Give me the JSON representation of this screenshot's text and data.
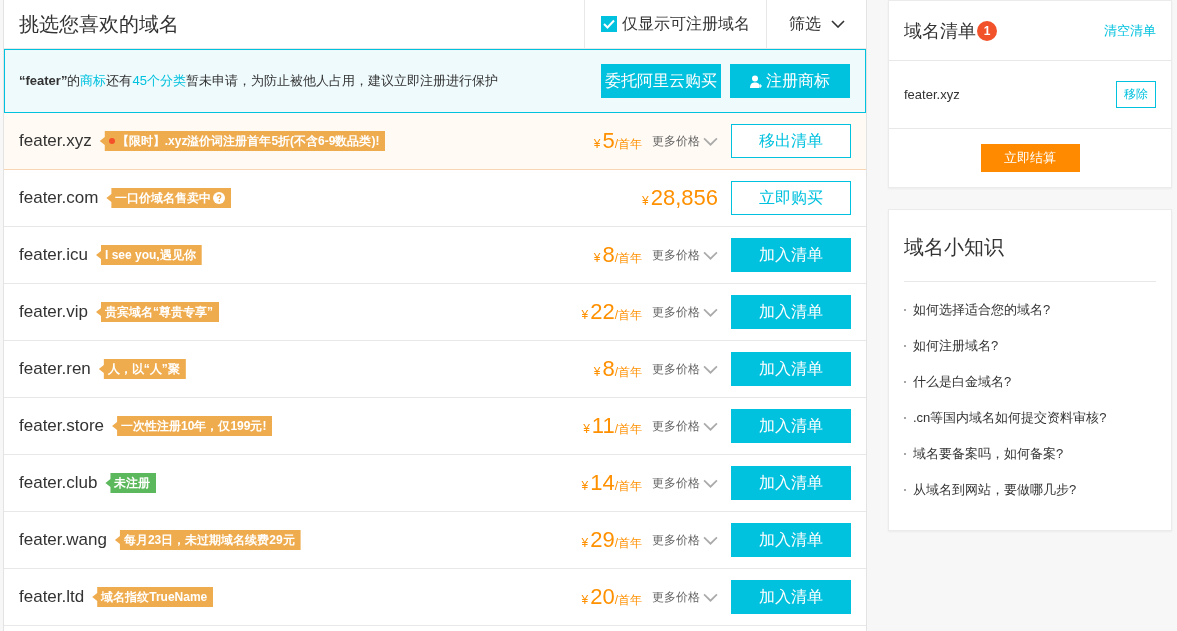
{
  "header": {
    "title": "挑选您喜欢的域名",
    "only_available": {
      "label": "仅显示可注册域名",
      "checked": true
    },
    "filter": {
      "label": "筛选"
    }
  },
  "trademark_banner": {
    "message": [
      {
        "kind": "text",
        "text": "**“feater”**的"
      },
      {
        "kind": "link",
        "text": "商标"
      },
      {
        "kind": "text",
        "text": "还有"
      },
      {
        "kind": "link",
        "text": "45个分类"
      },
      {
        "kind": "text",
        "text": "暂未申请，为防止被他人占用，建议立即注册进行保护"
      }
    ],
    "buttons": [
      {
        "label": "委托阿里云购买",
        "kind": "plain"
      },
      {
        "label": "注册商标",
        "kind": "with_icon"
      }
    ]
  },
  "rows": [
    {
      "domain": "feater.xyz",
      "in_cart": true,
      "tag": {
        "text": "【限时】.xyz溢价词注册首年5折(不含6-9数品类)!",
        "color": "#efac4f",
        "hot": true,
        "help": false
      },
      "price": {
        "currency": "¥",
        "amount": "5",
        "unit": "/首年"
      },
      "more_prices": "更多价格",
      "button": {
        "label": "移出清单",
        "kind": "outline"
      }
    },
    {
      "domain": "feater.com",
      "in_cart": false,
      "tag": {
        "text": "一口价域名售卖中",
        "color": "#efac4f",
        "hot": false,
        "help": true
      },
      "price": {
        "currency": "¥",
        "amount": "28,856"
      },
      "button": {
        "label": "立即购买",
        "kind": "outline"
      }
    },
    {
      "domain": "feater.icu",
      "in_cart": false,
      "tag": {
        "text": "I see you,遇见你",
        "color": "#efac4f",
        "hot": false,
        "help": false
      },
      "price": {
        "currency": "¥",
        "amount": "8",
        "unit": "/首年"
      },
      "more_prices": "更多价格",
      "button": {
        "label": "加入清单",
        "kind": "solid"
      }
    },
    {
      "domain": "feater.vip",
      "in_cart": false,
      "tag": {
        "text": "贵宾域名“尊贵专享”",
        "color": "#efac4f",
        "hot": false,
        "help": false
      },
      "price": {
        "currency": "¥",
        "amount": "22",
        "unit": "/首年"
      },
      "more_prices": "更多价格",
      "button": {
        "label": "加入清单",
        "kind": "solid"
      }
    },
    {
      "domain": "feater.ren",
      "in_cart": false,
      "tag": {
        "text": "人，以“人”聚",
        "color": "#efac4f",
        "hot": false,
        "help": false
      },
      "price": {
        "currency": "¥",
        "amount": "8",
        "unit": "/首年"
      },
      "more_prices": "更多价格",
      "button": {
        "label": "加入清单",
        "kind": "solid"
      }
    },
    {
      "domain": "feater.store",
      "in_cart": false,
      "tag": {
        "text": "一次性注册10年，仅199元!",
        "color": "#efac4f",
        "hot": false,
        "help": false
      },
      "price": {
        "currency": "¥",
        "amount": "11",
        "unit": "/首年"
      },
      "more_prices": "更多价格",
      "button": {
        "label": "加入清单",
        "kind": "solid"
      }
    },
    {
      "domain": "feater.club",
      "in_cart": false,
      "tag": {
        "text": "未注册",
        "color": "#5cb85c",
        "hot": false,
        "help": false
      },
      "price": {
        "currency": "¥",
        "amount": "14",
        "unit": "/首年"
      },
      "more_prices": "更多价格",
      "button": {
        "label": "加入清单",
        "kind": "solid"
      }
    },
    {
      "domain": "feater.wang",
      "in_cart": false,
      "tag": {
        "text": "每月23日，未过期域名续费29元",
        "color": "#efac4f",
        "hot": false,
        "help": false
      },
      "price": {
        "currency": "¥",
        "amount": "29",
        "unit": "/首年"
      },
      "more_prices": "更多价格",
      "button": {
        "label": "加入清单",
        "kind": "solid"
      }
    },
    {
      "domain": "feater.ltd",
      "in_cart": false,
      "tag": {
        "text": "域名指纹TrueName",
        "color": "#efac4f",
        "hot": false,
        "help": false
      },
      "price": {
        "currency": "¥",
        "amount": "20",
        "unit": "/首年"
      },
      "more_prices": "更多价格",
      "button": {
        "label": "加入清单",
        "kind": "solid"
      }
    }
  ],
  "cart": {
    "title": "域名清单",
    "count": "1",
    "clear": "清空清单",
    "items": [
      {
        "domain": "feater.xyz",
        "remove": "移除"
      }
    ],
    "checkout": "立即结算"
  },
  "tips": {
    "title": "域名小知识",
    "items": [
      "如何选择适合您的域名?",
      "如何注册域名?",
      "什么是白金域名?",
      ".cn等国内域名如何提交资料审核?",
      "域名要备案吗，如何备案?",
      "从域名到网站，要做哪几步?"
    ]
  }
}
